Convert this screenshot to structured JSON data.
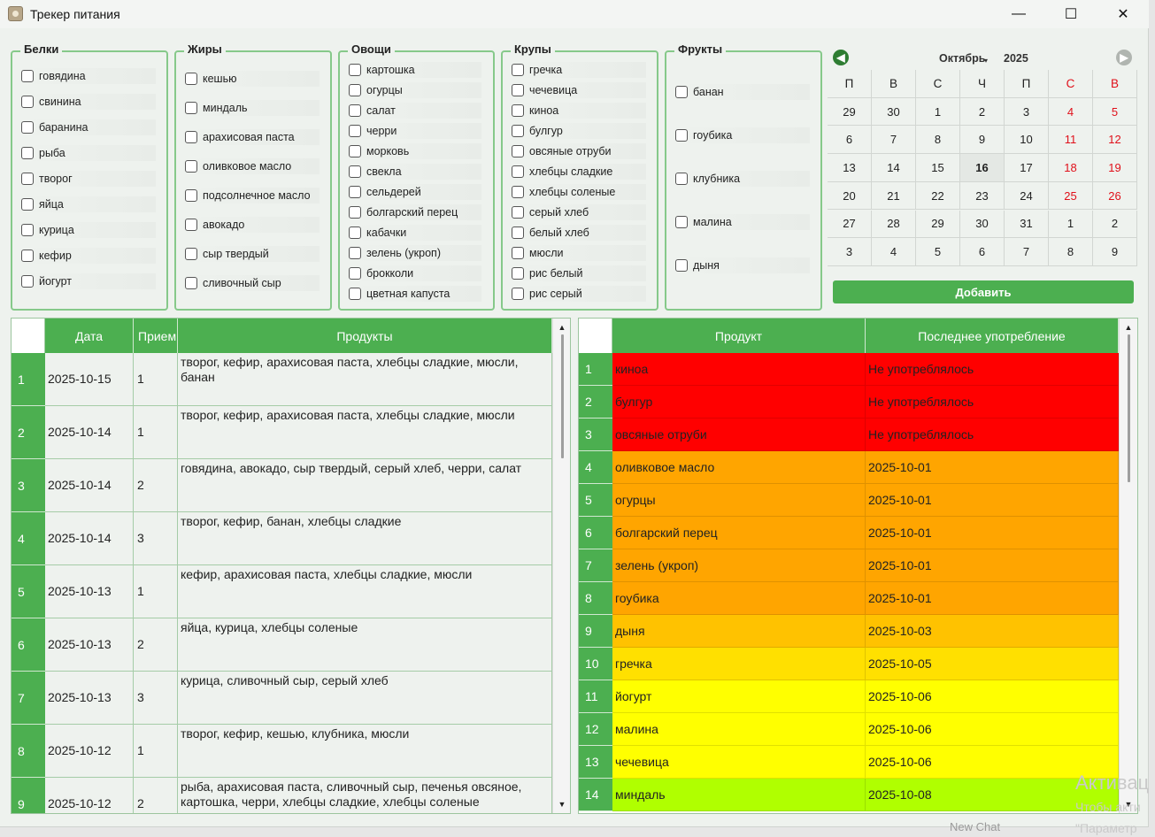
{
  "window": {
    "title": "Трекер питания",
    "controls": {
      "minimize": "—",
      "maximize": "☐",
      "close": "✕"
    }
  },
  "groups": [
    {
      "title": "Белки",
      "items": [
        "говядина",
        "свинина",
        "баранина",
        "рыба",
        "творог",
        "яйца",
        "курица",
        "кефир",
        "йогурт"
      ]
    },
    {
      "title": "Жиры",
      "items": [
        "кешью",
        "миндаль",
        "арахисовая паста",
        "оливковое масло",
        "подсолнечное масло",
        "авокадо",
        "сыр твердый",
        "сливочный сыр"
      ]
    },
    {
      "title": "Овощи",
      "items": [
        "картошка",
        "огурцы",
        "салат",
        "черри",
        "морковь",
        "свекла",
        "сельдерей",
        "болгарский перец",
        "кабачки",
        "зелень (укроп)",
        "брокколи",
        "цветная капуста"
      ]
    },
    {
      "title": "Крупы",
      "items": [
        "гречка",
        "чечевица",
        "киноа",
        "булгур",
        "овсяные отруби",
        "хлебцы сладкие",
        "хлебцы соленые",
        "серый хлеб",
        "белый хлеб",
        "мюсли",
        "рис белый",
        "рис серый"
      ]
    },
    {
      "title": "Фрукты",
      "items": [
        "банан",
        "гоубика",
        "клубника",
        "малина",
        "дыня"
      ]
    }
  ],
  "calendar": {
    "month": "Октябрь",
    "year": "2025",
    "weekdays": [
      "П",
      "В",
      "С",
      "Ч",
      "П",
      "С",
      "В"
    ],
    "weeks": [
      [
        "29",
        "30",
        "1",
        "2",
        "3",
        "4",
        "5"
      ],
      [
        "6",
        "7",
        "8",
        "9",
        "10",
        "11",
        "12"
      ],
      [
        "13",
        "14",
        "15",
        "16",
        "17",
        "18",
        "19"
      ],
      [
        "20",
        "21",
        "22",
        "23",
        "24",
        "25",
        "26"
      ],
      [
        "27",
        "28",
        "29",
        "30",
        "31",
        "1",
        "2"
      ],
      [
        "3",
        "4",
        "5",
        "6",
        "7",
        "8",
        "9"
      ]
    ],
    "selected_day": "16",
    "weekend_color": "#e0101a",
    "prev_icon": "arrow-left-icon",
    "next_icon": "arrow-right-icon"
  },
  "add_button": "Добавить",
  "meals_table": {
    "headers": [
      "Дата",
      "Прием",
      "Продукты"
    ],
    "rows": [
      {
        "n": "1",
        "date": "2025-10-15",
        "meal": "1",
        "products": "творог, кефир, арахисовая паста, хлебцы сладкие, мюсли, банан"
      },
      {
        "n": "2",
        "date": "2025-10-14",
        "meal": "1",
        "products": "творог, кефир, арахисовая паста, хлебцы сладкие, мюсли"
      },
      {
        "n": "3",
        "date": "2025-10-14",
        "meal": "2",
        "products": "говядина, авокадо, сыр твердый, серый хлеб, черри, салат"
      },
      {
        "n": "4",
        "date": "2025-10-14",
        "meal": "3",
        "products": "творог, кефир, банан, хлебцы сладкие"
      },
      {
        "n": "5",
        "date": "2025-10-13",
        "meal": "1",
        "products": "кефир, арахисовая паста, хлебцы сладкие, мюсли"
      },
      {
        "n": "6",
        "date": "2025-10-13",
        "meal": "2",
        "products": "яйца, курица, хлебцы соленые"
      },
      {
        "n": "7",
        "date": "2025-10-13",
        "meal": "3",
        "products": "курица, сливочный сыр, серый хлеб"
      },
      {
        "n": "8",
        "date": "2025-10-12",
        "meal": "1",
        "products": "творог, кефир, кешью, клубника, мюсли"
      },
      {
        "n": "9",
        "date": "2025-10-12",
        "meal": "2",
        "products": "рыба, арахисовая паста, сливочный сыр, печенья овсяное, картошка, черри, хлебцы сладкие, хлебцы соленые"
      }
    ]
  },
  "last_table": {
    "headers": [
      "Продукт",
      "Последнее употребление"
    ],
    "rows": [
      {
        "n": "1",
        "product": "киноа",
        "last": "Не употреблялось",
        "color": "#ff0000"
      },
      {
        "n": "2",
        "product": "булгур",
        "last": "Не употреблялось",
        "color": "#ff0000"
      },
      {
        "n": "3",
        "product": "овсяные отруби",
        "last": "Не употреблялось",
        "color": "#ff0000"
      },
      {
        "n": "4",
        "product": "оливковое масло",
        "last": "2025-10-01",
        "color": "#ffa500"
      },
      {
        "n": "5",
        "product": "огурцы",
        "last": "2025-10-01",
        "color": "#ffa500"
      },
      {
        "n": "6",
        "product": "болгарский перец",
        "last": "2025-10-01",
        "color": "#ffa500"
      },
      {
        "n": "7",
        "product": "зелень (укроп)",
        "last": "2025-10-01",
        "color": "#ffa500"
      },
      {
        "n": "8",
        "product": "гоубика",
        "last": "2025-10-01",
        "color": "#ffa500"
      },
      {
        "n": "9",
        "product": "дыня",
        "last": "2025-10-03",
        "color": "#ffc200"
      },
      {
        "n": "10",
        "product": "гречка",
        "last": "2025-10-05",
        "color": "#ffe000"
      },
      {
        "n": "11",
        "product": "йогурт",
        "last": "2025-10-06",
        "color": "#ffff00"
      },
      {
        "n": "12",
        "product": "малина",
        "last": "2025-10-06",
        "color": "#ffff00"
      },
      {
        "n": "13",
        "product": "чечевица",
        "last": "2025-10-06",
        "color": "#ffff00"
      },
      {
        "n": "14",
        "product": "миндаль",
        "last": "2025-10-08",
        "color": "#b0ff00"
      }
    ]
  },
  "watermark": {
    "line1": "Активац",
    "line2": "Чтобы акти",
    "line3": "\"Параметр",
    "taskbar_hint": "New Chat"
  }
}
